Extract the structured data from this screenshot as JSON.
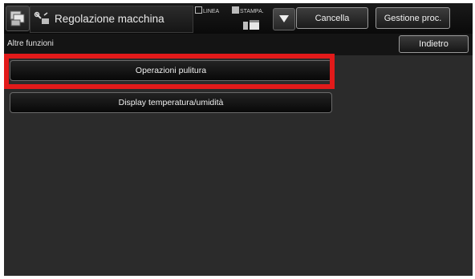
{
  "header": {
    "title": "Regolazione macchina",
    "home_icon": "stacked-documents-icon",
    "mode_icon": "machine-settings-icon",
    "indicators": [
      {
        "label": "LINEA",
        "checked": false
      },
      {
        "label": "STAMPA.",
        "checked": true
      }
    ],
    "cancel_label": "Cancella",
    "job_status_label": "Gestione proc."
  },
  "subheader": {
    "title": "Altre funzioni",
    "back_label": "Indietro"
  },
  "functions": [
    {
      "label": "Operazioni pulitura",
      "highlighted": true
    },
    {
      "label": "Display temperatura/umidità",
      "highlighted": false
    }
  ],
  "colors": {
    "highlight": "#e21a1a",
    "background": "#2b2b2b"
  }
}
